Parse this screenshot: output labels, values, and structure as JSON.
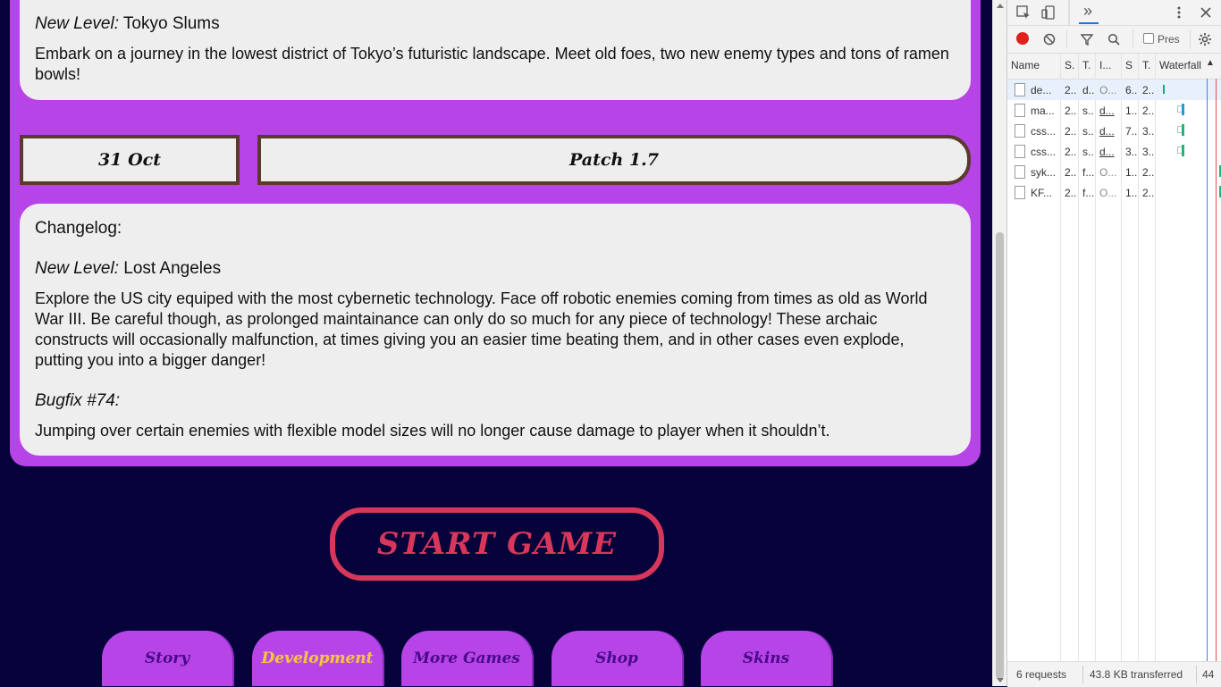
{
  "card_top": {
    "level_label": "New Level:",
    "level_name": " Tokyo Slums",
    "description": "Embark on a journey in the lowest district of Tokyo’s futuristic landscape. Meet old foes, two new enemy types and tons of ramen bowls!"
  },
  "patch_entry": {
    "date": "31 Oct",
    "title": "Patch 1.7"
  },
  "changelog": {
    "heading": "Changelog:",
    "level_label": "New Level:",
    "level_name": " Lost Angeles",
    "level_description": "Explore the US city equiped with the most cybernetic technology. Face off robotic enemies coming from times as old as World War III. Be careful though, as prolonged maintainance can only do so much for any piece of technology! These archaic constructs will occasionally malfunction, at times giving you an easier time beating them, and in other cases even explode, putting you into a bigger danger!",
    "bugfix_label": "Bugfix #74:",
    "bugfix_description": "Jumping over certain enemies with flexible model sizes will no longer cause damage to player when it shouldn’t."
  },
  "start_button": "START GAME",
  "nav": [
    {
      "label": "Story",
      "active": false
    },
    {
      "label": "Development",
      "active": true
    },
    {
      "label": "More Games",
      "active": false
    },
    {
      "label": "Shop",
      "active": false
    },
    {
      "label": "Skins",
      "active": false
    }
  ],
  "devtools": {
    "more_tabs": "»",
    "preserve_label": "Pres",
    "columns": [
      "Name",
      "S.",
      "T.",
      "I...",
      "S",
      "T.",
      "Waterfall"
    ],
    "rows": [
      {
        "name": "de...",
        "c1": "2..",
        "c2": "d..",
        "c3": "O...",
        "c4": "6..",
        "c5": "2..",
        "selected": true
      },
      {
        "name": "ma...",
        "c1": "2..",
        "c2": "s..",
        "c3": "d...",
        "c4": "1..",
        "c5": "2..",
        "selected": false
      },
      {
        "name": "css...",
        "c1": "2..",
        "c2": "s..",
        "c3": "d...",
        "c4": "7..",
        "c5": "3..",
        "selected": false
      },
      {
        "name": "css...",
        "c1": "2..",
        "c2": "s..",
        "c3": "d...",
        "c4": "3..",
        "c5": "3..",
        "selected": false
      },
      {
        "name": "syk...",
        "c1": "2..",
        "c2": "f...",
        "c3": "O...",
        "c4": "1..",
        "c5": "2..",
        "selected": false
      },
      {
        "name": "KF...",
        "c1": "2..",
        "c2": "f...",
        "c3": "O...",
        "c4": "1..",
        "c5": "2..",
        "selected": false
      }
    ],
    "footer_requests": "6 requests",
    "footer_transferred": "43.8 KB transferred",
    "footer_extra": "44"
  },
  "colors": {
    "page_bg": "#05033a",
    "panel_purple": "#b744e6",
    "card_bg": "#efeeee",
    "start_red": "#d8365a",
    "active_nav": "#f5c342"
  }
}
